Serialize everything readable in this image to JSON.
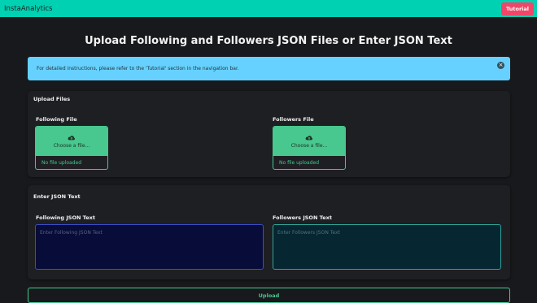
{
  "navbar": {
    "brand": "InstaAnalytics",
    "tutorial_label": "Tutorial"
  },
  "page_title": "Upload Following and Followers JSON Files or Enter JSON Text",
  "notification": {
    "message": "For detailed instructions, please refer to the 'Tutorial' section in the navigation bar."
  },
  "upload_files": {
    "heading": "Upload Files",
    "following": {
      "label": "Following File",
      "cta": "Choose a file...",
      "status": "No file uploaded"
    },
    "followers": {
      "label": "Followers File",
      "cta": "Choose a file...",
      "status": "No file uploaded"
    }
  },
  "json_text": {
    "heading": "Enter JSON Text",
    "following": {
      "label": "Following JSON Text",
      "placeholder": "Enter Following JSON Text"
    },
    "followers": {
      "label": "Followers JSON Text",
      "placeholder": "Enter Followers JSON Text"
    }
  },
  "upload_button": "Upload",
  "colors": {
    "navbar": "#00d1b2",
    "tutorial": "#f14668",
    "notification": "#66d1ff",
    "success": "#48c78e",
    "background": "#18191c"
  },
  "icons": {
    "file_cta": "cloud-upload-icon",
    "notification_close": "close-icon"
  }
}
